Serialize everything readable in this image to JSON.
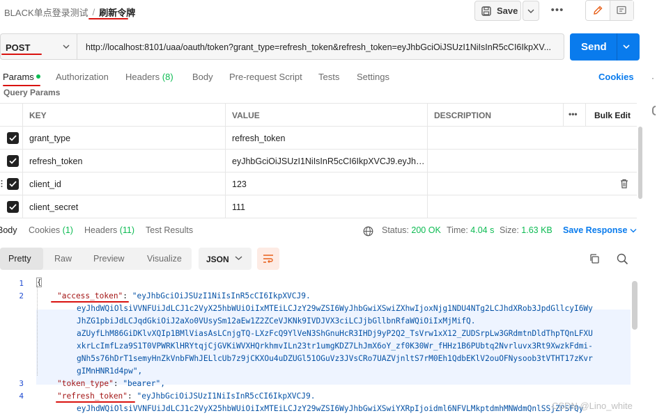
{
  "breadcrumb": {
    "collection": "BLACK单点登录测试",
    "separator": "/",
    "current": "刷新令牌"
  },
  "toolbar": {
    "save_label": "Save",
    "more": "•••"
  },
  "request": {
    "method": "POST",
    "url": "http://localhost:8101/uaa/oauth/token?grant_type=refresh_token&refresh_token=eyJhbGciOiJSUzI1NiIsInR5cCI6IkpXV...",
    "send_label": "Send"
  },
  "request_tabs": {
    "params": "Params",
    "authorization": "Authorization",
    "headers": "Headers",
    "headers_count": "(8)",
    "body": "Body",
    "prerequest": "Pre-request Script",
    "tests": "Tests",
    "settings": "Settings",
    "cookies": "Cookies"
  },
  "query_params_title": "Query Params",
  "params_table": {
    "headers": {
      "key": "KEY",
      "value": "VALUE",
      "description": "DESCRIPTION",
      "more": "•••",
      "bulk_edit": "Bulk Edit"
    },
    "rows": [
      {
        "key": "grant_type",
        "value": "refresh_token",
        "description": ""
      },
      {
        "key": "refresh_token",
        "value": "eyJhbGciOiJSUzI1NiIsInR5cCI6IkpXVCJ9.eyJhd...",
        "description": ""
      },
      {
        "key": "client_id",
        "value": "123",
        "description": ""
      },
      {
        "key": "client_secret",
        "value": "111",
        "description": ""
      }
    ]
  },
  "response": {
    "tabs": {
      "body": "Body",
      "cookies": "Cookies",
      "cookies_count": "(1)",
      "headers": "Headers",
      "headers_count": "(11)",
      "test_results": "Test Results"
    },
    "status_label": "Status:",
    "status_value": "200 OK",
    "time_label": "Time:",
    "time_value": "4.04 s",
    "size_label": "Size:",
    "size_value": "1.63 KB",
    "save_response": "Save Response"
  },
  "response_view": {
    "pretty": "Pretty",
    "raw": "Raw",
    "preview": "Preview",
    "visualize": "Visualize",
    "format": "JSON"
  },
  "code": {
    "line_numbers": [
      "1",
      "2",
      "3",
      "4"
    ],
    "open_brace": "{",
    "access_token_key": "\"access_token\"",
    "access_token_first": "\"eyJhbGciOiJSUzI1NiIsInR5cCI6IkpXVCJ9.",
    "access_token_cont": [
      "eyJhdWQiOlsiVVNFUiJdLCJ1c2VyX25hbWUiOiIxMTEiLCJzY29wZSI6WyJhbGwiXSwiZXhwIjoxNjg1NDU4NTg2LCJhdXRob3JpdGllcyI6Wy",
      "JhZG1pbiJdLCJqdGkiOiJ2aXo0VUsySm12aEw1Z2ZCeVJKNk9IVDJVX3ciLCJjbGllbnRfaWQiOiIxMjMifQ.",
      "aZUyfLhM86GiDKlvXQIp1BMlViasAsLCnjgTQ-LXzFcQ9YlVeN3ShGnuHcR3IHDj9yP2Q2_TsVrw1xX12_ZUDSrpLw3GRdmtnDldThpTQnLFXU",
      "xkrLcImfLza9S1T0VPWRKlHRYtqjCjGVKiWVXHQrkhmvILn23tr1umgKDZ7LhJmX6oY_zf0K30Wr_fHHz1B6PUbtq2Nvrluvx3Rt9XwzkFdmi-",
      "gNh5s76hDrT1semyHnZkVnbFWhJELlcUb7z9jCKXOu4uDZUGl51OGuVz3JVsCRo7UAZVjnltS7rM0Eh1QdbEKlV2ouOFNysoob3tVTHT17zKvr",
      "gIMnHNR1d4pw\","
    ],
    "token_type_key": "\"token_type\"",
    "token_type_value": "\"bearer\",",
    "refresh_token_key": "\"refresh_token\"",
    "refresh_token_first": "\"eyJhbGciOiJSUzI1NiIsInR5cCI6IkpXVCJ9.",
    "refresh_token_cont": "eyJhdWQiOlsiVVNFUiJdLCJ1c2VyX25hbWUiOiIxMTEiLCJzY29wZSI6WyJhbGwiXSwiYXRpIjoidml6NFVLMkptdmhMNWdmQnlSSjZPSFQy"
  },
  "watermark": "CSDN @Lino_white",
  "colors": {
    "accent": "#097bed",
    "status_ok": "#0cbb52",
    "annotation": "#d9120f"
  }
}
